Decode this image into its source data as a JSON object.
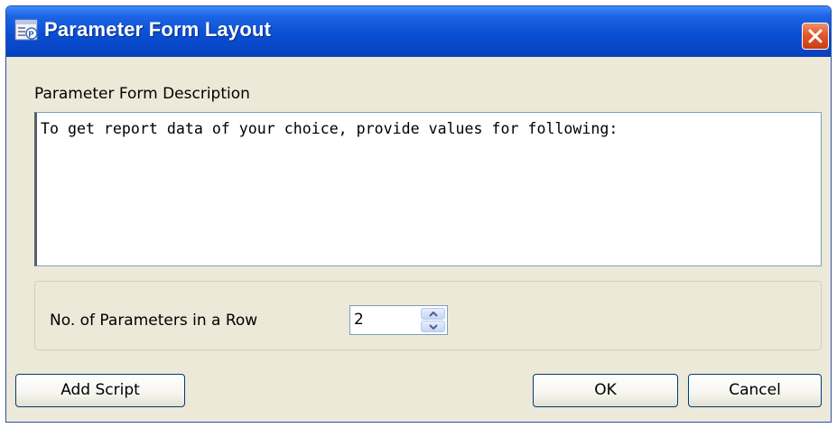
{
  "window": {
    "title": "Parameter Form Layout",
    "icon": "report-parameters-icon",
    "close_icon": "close-icon"
  },
  "description": {
    "label": "Parameter Form Description",
    "value": "To get report data of your choice, provide values for following:"
  },
  "parameters": {
    "label": "No. of Parameters in a Row",
    "value": "2"
  },
  "buttons": {
    "add_script": "Add Script",
    "ok": "OK",
    "cancel": "Cancel"
  },
  "colors": {
    "titlebar": "#0a4fd4",
    "close_button": "#e2582c",
    "dialog_background": "#ece9d8"
  }
}
